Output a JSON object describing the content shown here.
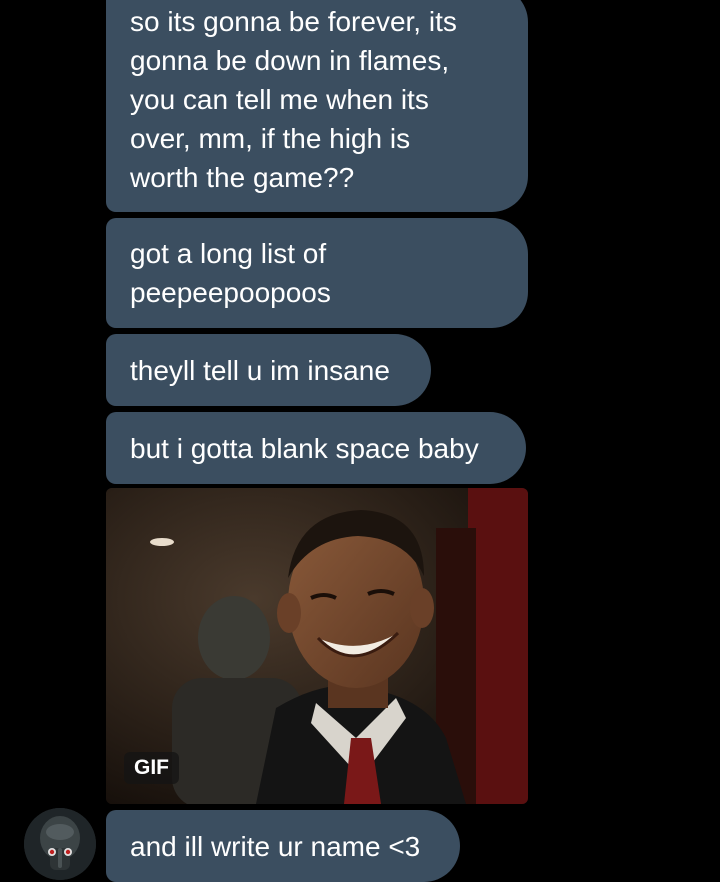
{
  "messages": [
    {
      "text": "so its gonna be forever, its\ngonna be down in flames,\nyou can tell me when its\nover, mm, if the high is\nworth the game??"
    },
    {
      "text": "got a long list of\npeepeepoopoos"
    },
    {
      "text": "theyll tell u im insane"
    },
    {
      "text": "but i gotta blank space baby"
    },
    {
      "gif_badge": "GIF"
    },
    {
      "text": "and ill write ur name <3"
    }
  ],
  "colors": {
    "background": "#000000",
    "bubble": "#3b4e60",
    "bubble_text": "#ffffff"
  },
  "avatar": {
    "icon": "squidward-avatar-icon"
  }
}
